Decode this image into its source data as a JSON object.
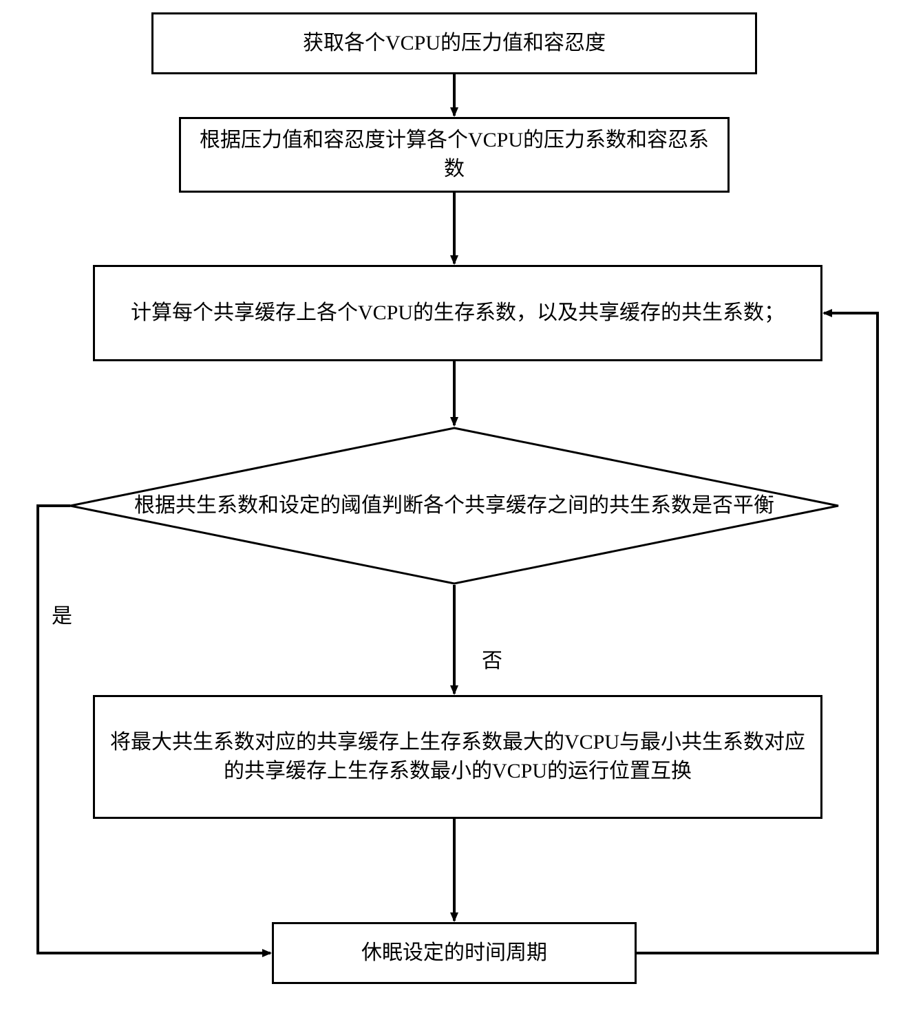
{
  "chart_data": {
    "type": "flowchart",
    "nodes": [
      {
        "id": "n1",
        "shape": "rect",
        "text": "获取各个VCPU的压力值和容忍度"
      },
      {
        "id": "n2",
        "shape": "rect",
        "text": "根据压力值和容忍度计算各个VCPU的压力系数和容忍系数"
      },
      {
        "id": "n3",
        "shape": "rect",
        "text": "计算每个共享缓存上各个VCPU的生存系数，以及共享缓存的共生系数；"
      },
      {
        "id": "n4",
        "shape": "diamond",
        "text": "根据共生系数和设定的阈值判断各个共享缓存之间的共生系数是否平衡"
      },
      {
        "id": "n5",
        "shape": "rect",
        "text": "将最大共生系数对应的共享缓存上生存系数最大的VCPU与最小共生系数对应的共享缓存上生存系数最小的VCPU的运行位置互换"
      },
      {
        "id": "n6",
        "shape": "rect",
        "text": "休眠设定的时间周期"
      }
    ],
    "edges": [
      {
        "from": "n1",
        "to": "n2",
        "label": ""
      },
      {
        "from": "n2",
        "to": "n3",
        "label": ""
      },
      {
        "from": "n3",
        "to": "n4",
        "label": ""
      },
      {
        "from": "n4",
        "to": "n5",
        "label": "否"
      },
      {
        "from": "n4",
        "to": "n6",
        "label": "是"
      },
      {
        "from": "n5",
        "to": "n6",
        "label": ""
      },
      {
        "from": "n6",
        "to": "n3",
        "label": ""
      }
    ]
  },
  "labels": {
    "yes": "是",
    "no": "否"
  }
}
